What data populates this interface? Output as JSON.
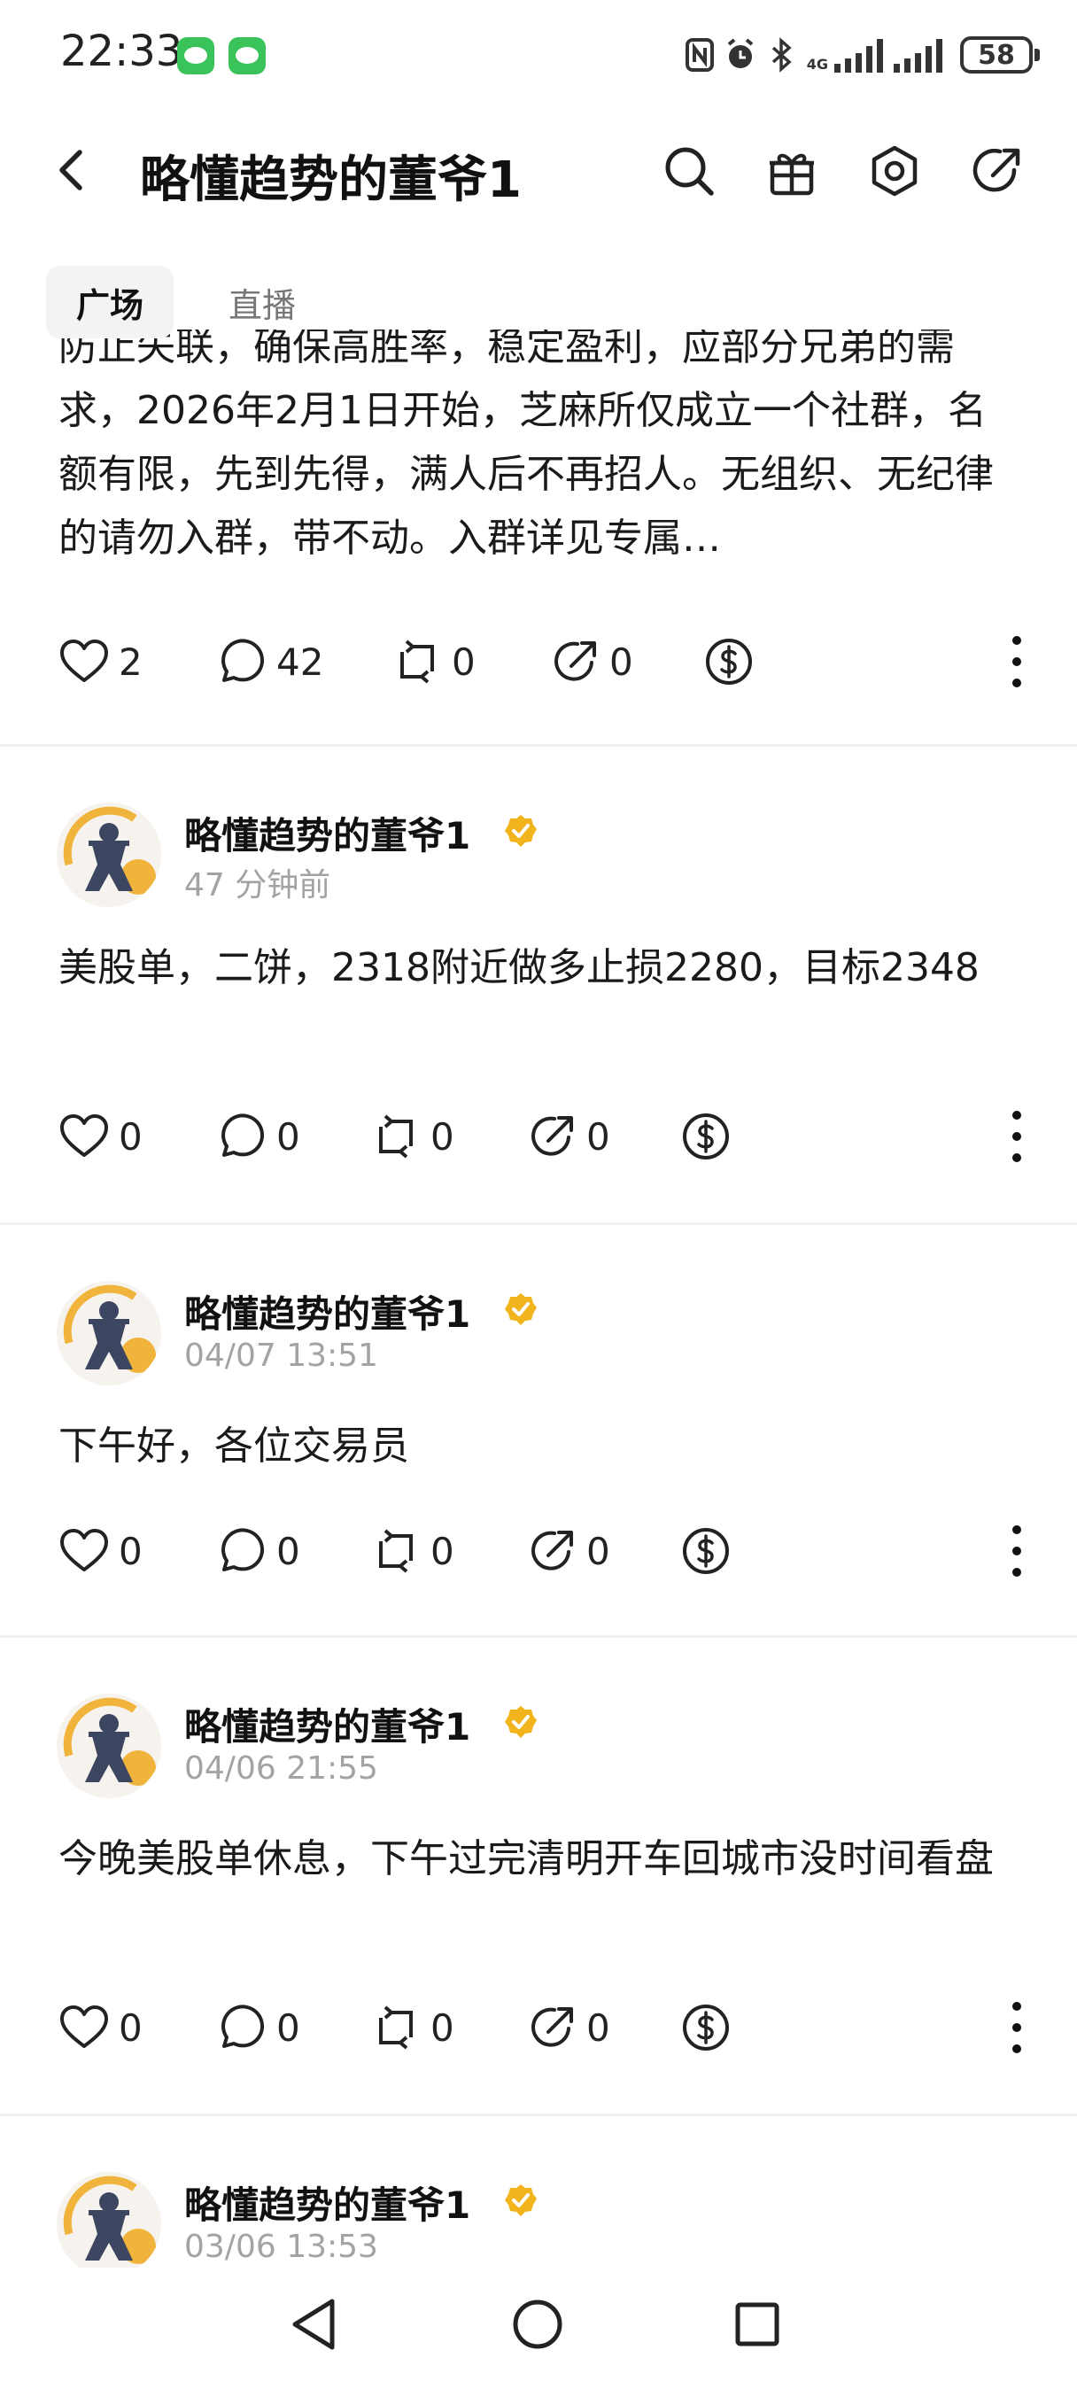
{
  "status_bar": {
    "time": "22:33",
    "battery": "58",
    "signal_badge": "4G",
    "icons": [
      "wechat-icon",
      "wechat-icon",
      "nfc-icon",
      "alarm-icon",
      "bluetooth-icon",
      "signal-icon",
      "signal-icon",
      "battery-icon"
    ]
  },
  "header": {
    "title": "略懂趋势的董爷1",
    "icons": [
      "back-icon",
      "search-icon",
      "gift-icon",
      "settings-icon",
      "share-icon"
    ]
  },
  "tabs": [
    {
      "label": "广场",
      "active": true
    },
    {
      "label": "直播",
      "active": false
    }
  ],
  "colors": {
    "verified": "#f2b41c",
    "muted_text": "#a3a3a3",
    "tab_bg": "#f2f3f5",
    "avatar_accent": "#f0b43c"
  },
  "feed": {
    "first_post_partial_text": "防止失联，确保高胜率，稳定盈利，应部分兄弟的需求，2026年2月1日开始，芝麻所仅成立一个社群，名额有限，先到先得，满人后不再招人。无组织、无纪律的请勿入群，带不动。入群详见专属…",
    "first_post_actions": {
      "likes": "2",
      "comments": "42",
      "reposts": "0",
      "shares": "0"
    },
    "posts": [
      {
        "author": "略懂趋势的董爷1",
        "time": "47 分钟前",
        "content": "美股单，二饼，2318附近做多止损2280，目标2348",
        "likes": "0",
        "comments": "0",
        "reposts": "0",
        "shares": "0"
      },
      {
        "author": "略懂趋势的董爷1",
        "time": "04/07 13:51",
        "content": "下午好，各位交易员",
        "likes": "0",
        "comments": "0",
        "reposts": "0",
        "shares": "0"
      },
      {
        "author": "略懂趋势的董爷1",
        "time": "04/06 21:55",
        "content": "今晚美股单休息，下午过完清明开车回城市没时间看盘",
        "likes": "0",
        "comments": "0",
        "reposts": "0",
        "shares": "0"
      },
      {
        "author": "略懂趋势的董爷1",
        "time": "03/06 13:53"
      }
    ]
  },
  "nav": {
    "icons": [
      "back-triangle-icon",
      "home-circle-icon",
      "recents-square-icon"
    ]
  }
}
